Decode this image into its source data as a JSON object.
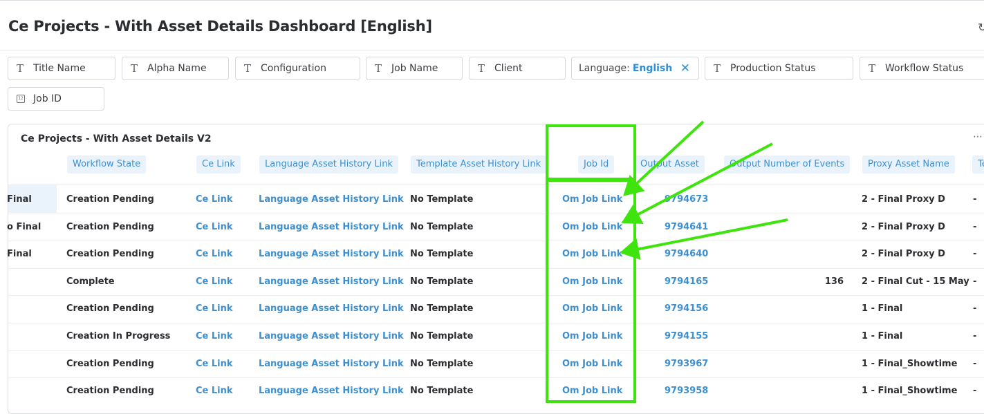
{
  "dashboard": {
    "title": "Ce Projects - With Asset Details Dashboard [English]"
  },
  "filters": {
    "title_name": "Title Name",
    "alpha_name": "Alpha Name",
    "configuration": "Configuration",
    "job_name": "Job Name",
    "client": "Client",
    "language_label": "Language:",
    "language_value": "English",
    "production_status": "Production Status",
    "workflow_status": "Workflow Status",
    "job_id": "Job ID",
    "job_id_icon_text": "12"
  },
  "table": {
    "title": "Ce Projects - With Asset Details V2",
    "headers": {
      "workflow_state": "Workflow State",
      "ce_link": "Ce Link",
      "language_asset_history_link": "Language Asset History Link",
      "template_asset_history_link": "Template Asset History Link",
      "job_id": "Job Id",
      "output_asset": "Output Asset",
      "output_number_of_events": "Output Number of Events",
      "proxy_asset_name": "Proxy Asset Name",
      "next_partial": "Te"
    },
    "rows": [
      {
        "first": "Final",
        "workflow_state": "Creation Pending",
        "ce_link": "Ce Link",
        "lang_link": "Language Asset History Link",
        "template": "No Template",
        "job_link": "Om Job Link",
        "output_asset": "9794673",
        "events": "",
        "proxy": "2 - Final Proxy D",
        "next": "-"
      },
      {
        "first": "o Final",
        "workflow_state": "Creation Pending",
        "ce_link": "Ce Link",
        "lang_link": "Language Asset History Link",
        "template": "No Template",
        "job_link": "Om Job Link",
        "output_asset": "9794641",
        "events": "",
        "proxy": "2 - Final Proxy D",
        "next": "-"
      },
      {
        "first": "Final",
        "workflow_state": "Creation Pending",
        "ce_link": "Ce Link",
        "lang_link": "Language Asset History Link",
        "template": "No Template",
        "job_link": "Om Job Link",
        "output_asset": "9794640",
        "events": "",
        "proxy": "2 - Final Proxy D",
        "next": "-"
      },
      {
        "first": "",
        "workflow_state": "Complete",
        "ce_link": "Ce Link",
        "lang_link": "Language Asset History Link",
        "template": "No Template",
        "job_link": "Om Job Link",
        "output_asset": "9794165",
        "events": "136",
        "proxy": "2 - Final Cut - 15 May",
        "next": "-"
      },
      {
        "first": "",
        "workflow_state": "Creation Pending",
        "ce_link": "Ce Link",
        "lang_link": "Language Asset History Link",
        "template": "No Template",
        "job_link": "Om Job Link",
        "output_asset": "9794156",
        "events": "",
        "proxy": "1 - Final",
        "next": "-"
      },
      {
        "first": "",
        "workflow_state": "Creation In Progress",
        "ce_link": "Ce Link",
        "lang_link": "Language Asset History Link",
        "template": "No Template",
        "job_link": "Om Job Link",
        "output_asset": "9794155",
        "events": "",
        "proxy": "1 - Final",
        "next": "-"
      },
      {
        "first": "",
        "workflow_state": "Creation Pending",
        "ce_link": "Ce Link",
        "lang_link": "Language Asset History Link",
        "template": "No Template",
        "job_link": "Om Job Link",
        "output_asset": "9793967",
        "events": "",
        "proxy": "1 - Final_Showtime",
        "next": "-"
      },
      {
        "first": "",
        "workflow_state": "Creation Pending",
        "ce_link": "Ce Link",
        "lang_link": "Language Asset History Link",
        "template": "No Template",
        "job_link": "Om Job Link",
        "output_asset": "9793958",
        "events": "",
        "proxy": "1 - Final_Showtime",
        "next": "-"
      }
    ]
  },
  "annotation": {
    "highlight_color": "#3fe40f",
    "link_color": "#3e8fd0"
  }
}
